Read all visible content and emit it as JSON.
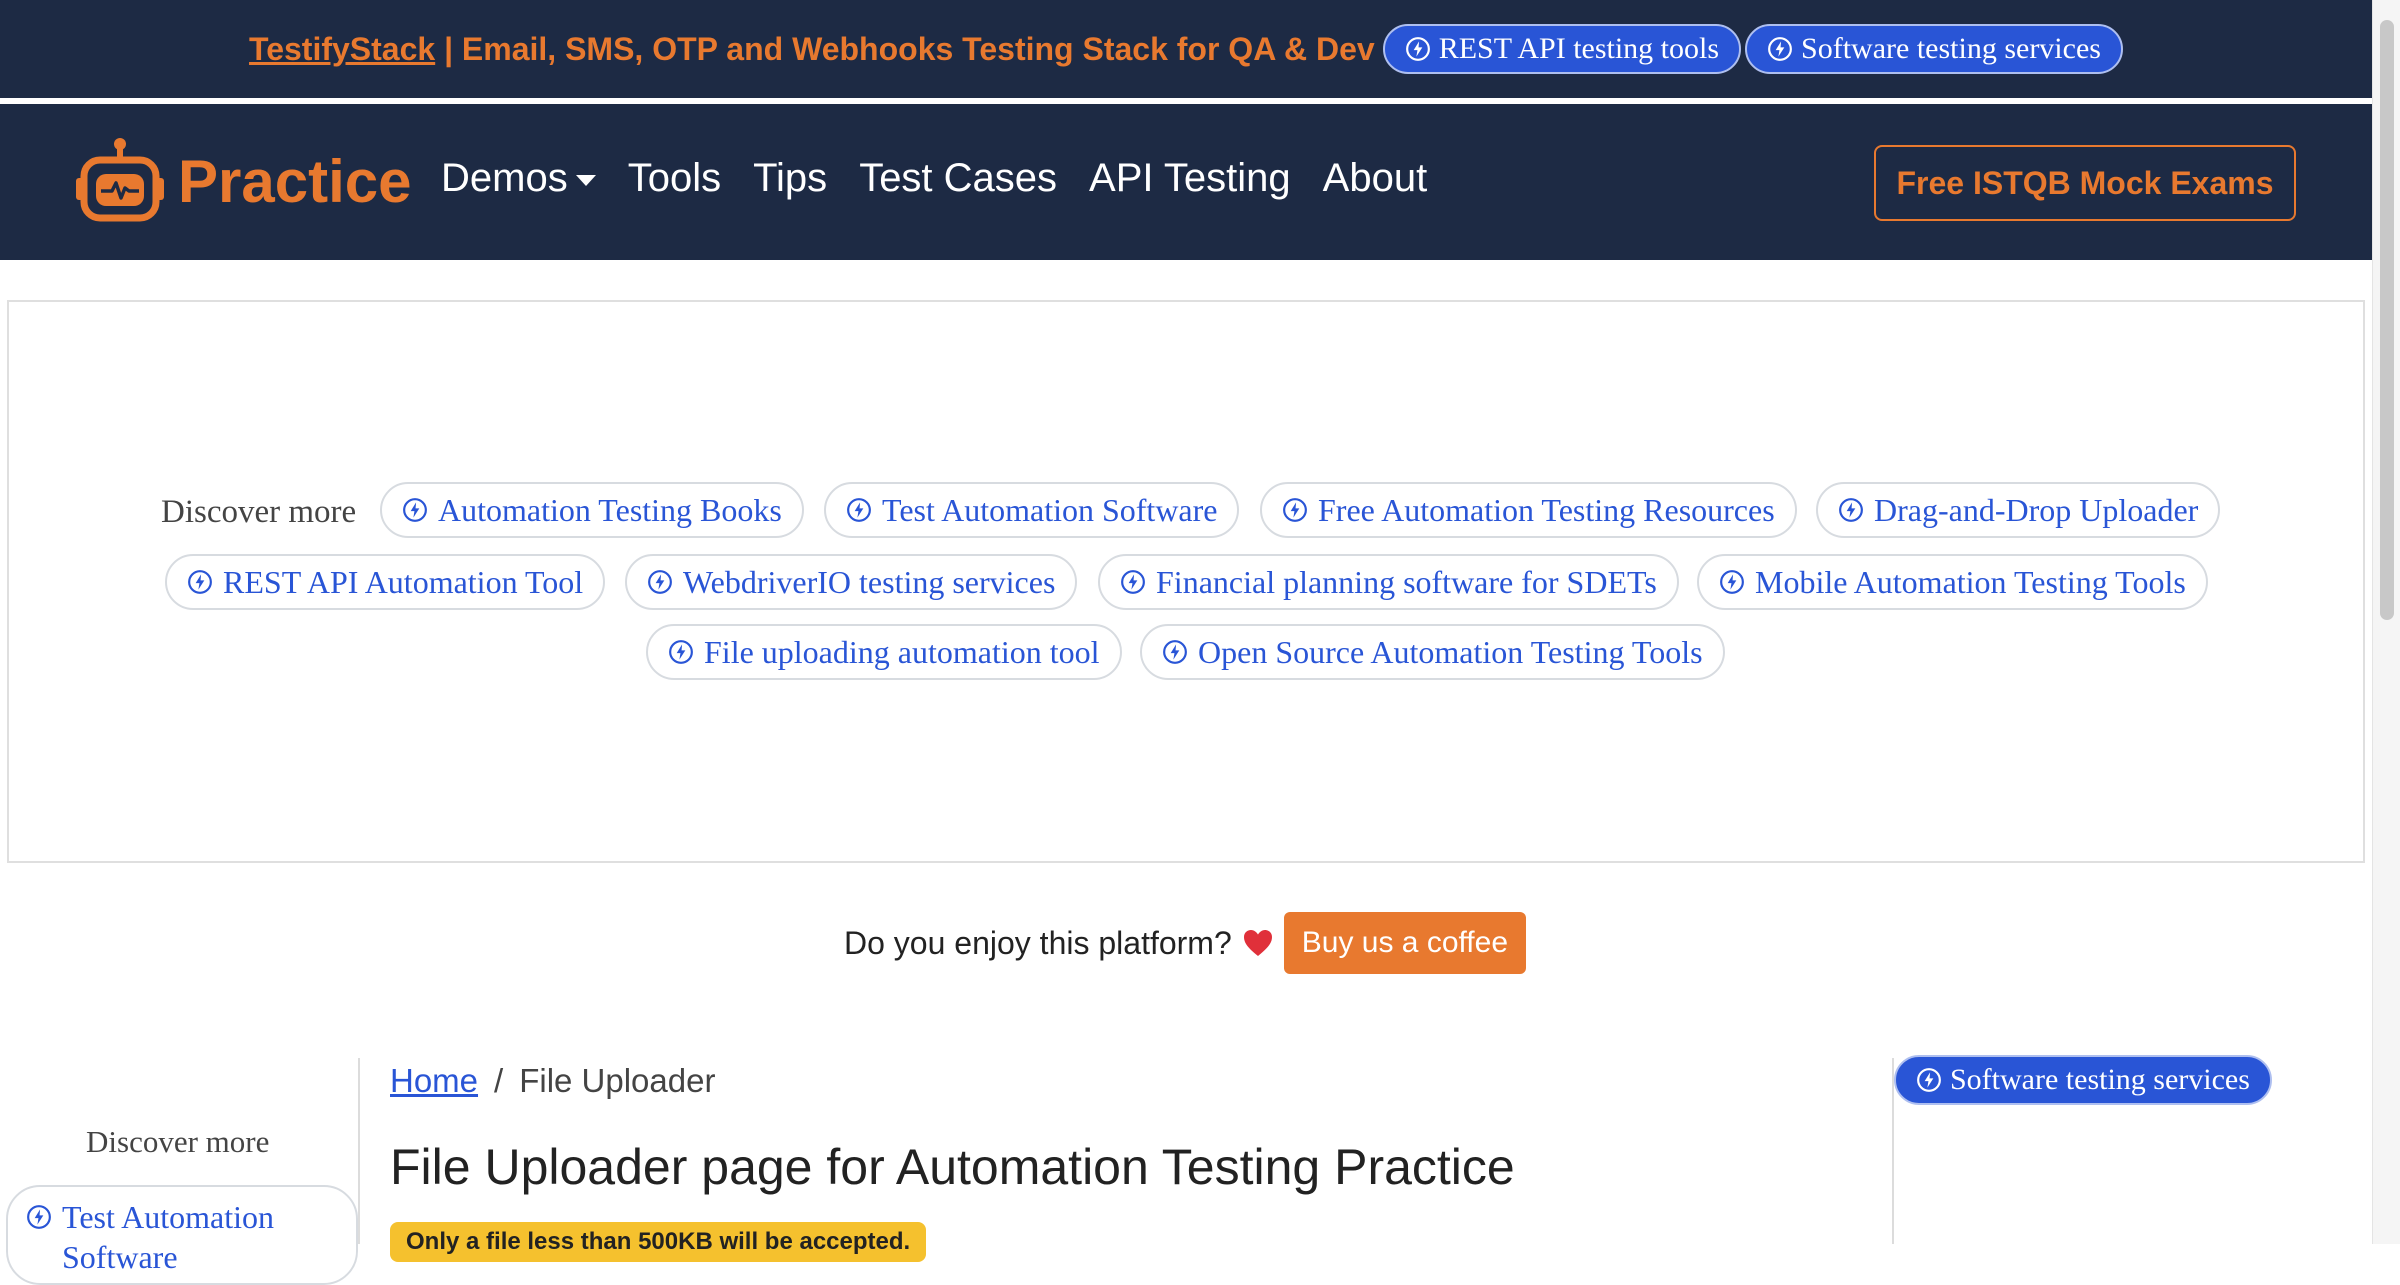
{
  "promo": {
    "brand_link": "TestifyStack",
    "text": " | Email, SMS, OTP and Webhooks Testing Stack for QA & Dev",
    "pill_1": "REST API testing tools",
    "pill_2": "Software testing services"
  },
  "nav": {
    "logo_text": "Practice",
    "links": [
      "Demos",
      "Tools",
      "Tips",
      "Test Cases",
      "API Testing",
      "About"
    ],
    "cta": "Free ISTQB Mock Exams"
  },
  "discover": {
    "label": "Discover more",
    "chips": [
      "Automation Testing Books",
      "Test Automation Software",
      "Free Automation Testing Resources",
      "Drag-and-Drop Uploader",
      "REST API Automation Tool",
      "WebdriverIO testing services",
      "Financial planning software for SDETs",
      "Mobile Automation Testing Tools",
      "File uploading automation tool",
      "Open Source Automation Testing Tools"
    ]
  },
  "support": {
    "question": "Do you enjoy this platform?",
    "button": "Buy us a coffee"
  },
  "sidebar": {
    "label": "Discover more",
    "chip": "Test Automation Software"
  },
  "breadcrumb": {
    "home": "Home",
    "separator": "/",
    "current": "File Uploader"
  },
  "main": {
    "title": "File Uploader page for Automation Testing Practice",
    "badge": "Only a file less than 500KB will be accepted."
  },
  "right_panel": {
    "pill": "Software testing services"
  },
  "colors": {
    "navy": "#1d2a44",
    "accent_orange": "#e8792f",
    "link_blue": "#2955d6",
    "badge_yellow": "#f5c12e"
  },
  "icons": {
    "chip_icon": "bolt-circle-icon",
    "logo_icon": "robot-icon",
    "heart_icon": "heart-icon"
  }
}
